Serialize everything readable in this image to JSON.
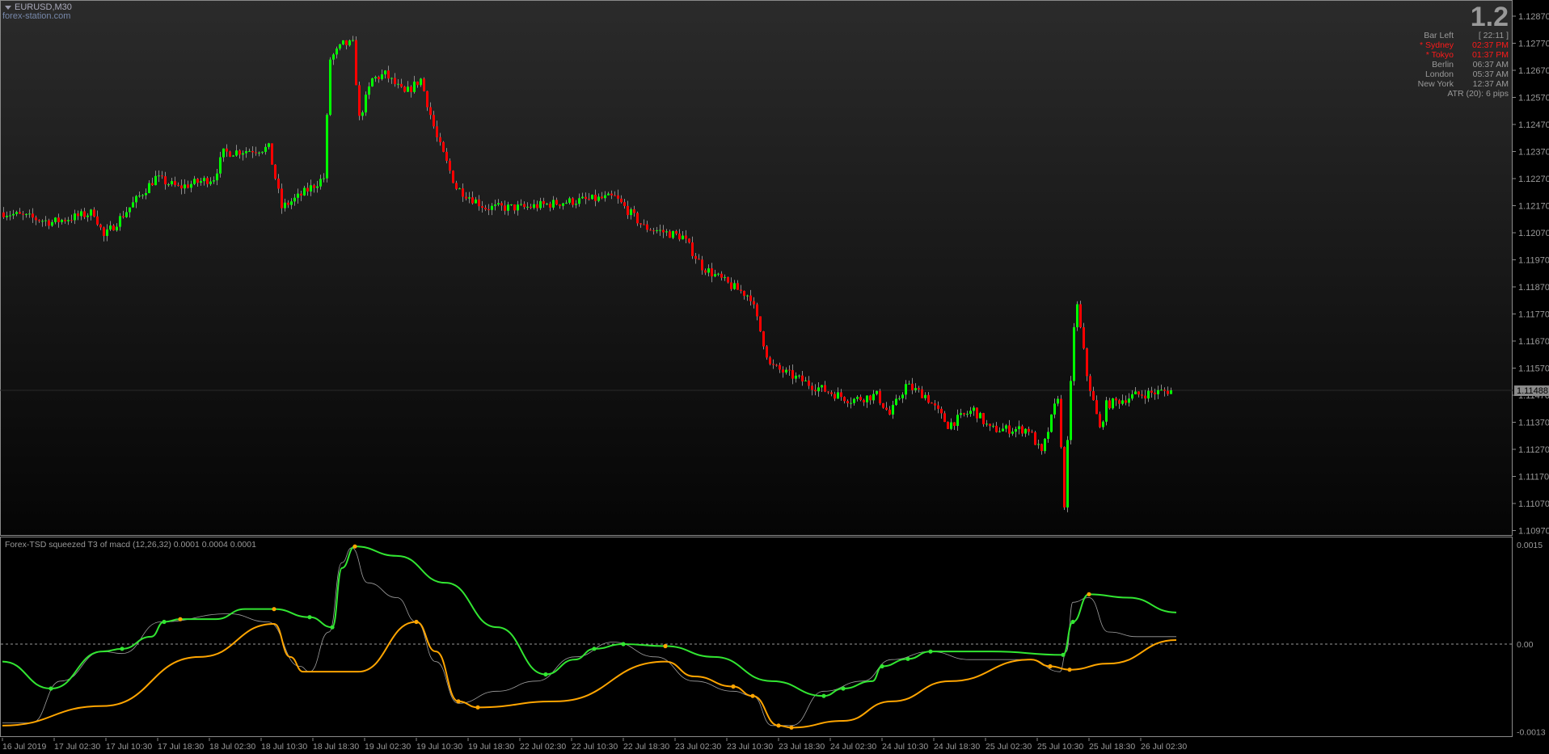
{
  "header": {
    "symbol": "EURUSD,M30",
    "site": "forex-station.com"
  },
  "info_panel": {
    "spread": "1.2",
    "rows": [
      {
        "label": "Bar Left",
        "value": "[ 22:11 ]",
        "color": "#999999"
      },
      {
        "label": "* Sydney",
        "value": "02:37 PM",
        "color": "#ff1a1a"
      },
      {
        "label": "* Tokyo",
        "value": "01:37 PM",
        "color": "#ff1a1a"
      },
      {
        "label": "Berlin",
        "value": "06:37 AM",
        "color": "#999999"
      },
      {
        "label": "London",
        "value": "05:37 AM",
        "color": "#999999"
      },
      {
        "label": "New York",
        "value": "12:37 AM",
        "color": "#999999"
      }
    ],
    "atr": "ATR (20): 6 pips"
  },
  "indicator": {
    "label": "Forex-TSD squeezed T3 of macd (12,26,32) 0.0001 0.0004 0.0001"
  },
  "colors": {
    "bull": "#00ff00",
    "bear": "#ff0000",
    "wick": "#8a8a8a",
    "signal": "#ffa500",
    "macd": "#32e632",
    "raw": "#a0a0a0"
  },
  "chart_data": [
    {
      "type": "candlestick",
      "title": "EURUSD,M30",
      "ylim": [
        1.10937,
        1.1289
      ],
      "price_ticks": [
        "1.12870",
        "1.12770",
        "1.12670",
        "1.12570",
        "1.12470",
        "1.12370",
        "1.12270",
        "1.12170",
        "1.12070",
        "1.11970",
        "1.11870",
        "1.11770",
        "1.11670",
        "1.11570",
        "1.11470",
        "1.11370",
        "1.11270",
        "1.11170",
        "1.11070",
        "1.10970"
      ],
      "current_price": "1.11488",
      "x_ticks": [
        "16 Jul 2019",
        "17 Jul 02:30",
        "17 Jul 10:30",
        "17 Jul 18:30",
        "18 Jul 02:30",
        "18 Jul 10:30",
        "18 Jul 18:30",
        "19 Jul 02:30",
        "19 Jul 10:30",
        "19 Jul 18:30",
        "22 Jul 02:30",
        "22 Jul 10:30",
        "22 Jul 18:30",
        "23 Jul 02:30",
        "23 Jul 10:30",
        "23 Jul 18:30",
        "24 Jul 02:30",
        "24 Jul 10:30",
        "24 Jul 18:30",
        "25 Jul 02:30",
        "25 Jul 10:30",
        "25 Jul 18:30",
        "26 Jul 02:30"
      ],
      "bars_per_tick": 16,
      "bar_count": 362,
      "close_keypoints": [
        [
          0,
          1.12145
        ],
        [
          15,
          1.12109
        ],
        [
          28,
          1.12145
        ],
        [
          31,
          1.12055
        ],
        [
          47,
          1.12273
        ],
        [
          54,
          1.12237
        ],
        [
          65,
          1.12273
        ],
        [
          68,
          1.12365
        ],
        [
          82,
          1.12383
        ],
        [
          86,
          1.12163
        ],
        [
          91,
          1.12201
        ],
        [
          99,
          1.12273
        ],
        [
          101,
          1.12712
        ],
        [
          105,
          1.12766
        ],
        [
          108,
          1.12766
        ],
        [
          110,
          1.12491
        ],
        [
          114,
          1.12637
        ],
        [
          118,
          1.12655
        ],
        [
          124,
          1.12583
        ],
        [
          129,
          1.12637
        ],
        [
          134,
          1.12419
        ],
        [
          140,
          1.12237
        ],
        [
          149,
          1.12163
        ],
        [
          161,
          1.12163
        ],
        [
          173,
          1.12183
        ],
        [
          189,
          1.12201
        ],
        [
          198,
          1.12091
        ],
        [
          210,
          1.12055
        ],
        [
          216,
          1.11945
        ],
        [
          225,
          1.11873
        ],
        [
          231,
          1.11834
        ],
        [
          237,
          1.1158
        ],
        [
          250,
          1.11506
        ],
        [
          262,
          1.11452
        ],
        [
          270,
          1.1147
        ],
        [
          274,
          1.11398
        ],
        [
          279,
          1.11506
        ],
        [
          285,
          1.1147
        ],
        [
          292,
          1.1136
        ],
        [
          300,
          1.11416
        ],
        [
          305,
          1.11344
        ],
        [
          317,
          1.11344
        ],
        [
          321,
          1.11252
        ],
        [
          326,
          1.1147
        ],
        [
          328,
          1.1107
        ],
        [
          331,
          1.11727
        ],
        [
          332,
          1.11798
        ],
        [
          335,
          1.11545
        ],
        [
          339,
          1.11344
        ],
        [
          341,
          1.11434
        ],
        [
          350,
          1.1147
        ],
        [
          361,
          1.11488
        ]
      ]
    },
    {
      "type": "line",
      "title": "Forex-TSD squeezed T3 of macd (12,26,32)",
      "ylim": [
        -0.0013,
        0.0015
      ],
      "y_ticks": [
        "0.0015",
        "0.00",
        "-0.0013"
      ],
      "zero_line": "dashed",
      "series": [
        {
          "name": "macd",
          "color": "#32e632",
          "points": [
            [
              0,
              -0.00026
            ],
            [
              15,
              -0.00066
            ],
            [
              31,
              -0.00011
            ],
            [
              37,
              -7e-05
            ],
            [
              46,
              0.00011
            ],
            [
              50,
              0.00033
            ],
            [
              55,
              0.00037
            ],
            [
              66,
              0.00037
            ],
            [
              75,
              0.00052
            ],
            [
              84,
              0.00052
            ],
            [
              95,
              0.0004
            ],
            [
              102,
              0.00025
            ],
            [
              105,
              0.00113
            ],
            [
              109,
              0.00145
            ],
            [
              122,
              0.00131
            ],
            [
              137,
              0.00091
            ],
            [
              153,
              0.00025
            ],
            [
              168,
              -0.00045
            ],
            [
              177,
              -0.00023
            ],
            [
              183,
              -7e-05
            ],
            [
              192,
              0.0
            ],
            [
              205,
              -3e-05
            ],
            [
              220,
              -0.00019
            ],
            [
              238,
              -0.00055
            ],
            [
              254,
              -0.00077
            ],
            [
              260,
              -0.00066
            ],
            [
              269,
              -0.00055
            ],
            [
              272,
              -0.00033
            ],
            [
              280,
              -0.00022
            ],
            [
              287,
              -0.00011
            ],
            [
              306,
              -0.00011
            ],
            [
              328,
              -0.00016
            ],
            [
              331,
              0.00033
            ],
            [
              336,
              0.00074
            ],
            [
              348,
              0.00069
            ],
            [
              363,
              0.00047
            ]
          ]
        },
        {
          "name": "signal",
          "color": "#ffa500",
          "points": [
            [
              0,
              -0.00121
            ],
            [
              31,
              -0.00092
            ],
            [
              61,
              -0.00019
            ],
            [
              84,
              0.0003
            ],
            [
              89,
              -0.00019
            ],
            [
              93,
              -0.00041
            ],
            [
              110,
              -0.00041
            ],
            [
              128,
              0.00033
            ],
            [
              134,
              -0.00011
            ],
            [
              141,
              -0.00085
            ],
            [
              147,
              -0.00094
            ],
            [
              171,
              -0.00085
            ],
            [
              205,
              -0.00026
            ],
            [
              214,
              -0.00048
            ],
            [
              226,
              -0.00063
            ],
            [
              232,
              -0.00077
            ],
            [
              240,
              -0.00121
            ],
            [
              244,
              -0.00124
            ],
            [
              260,
              -0.00114
            ],
            [
              275,
              -0.00085
            ],
            [
              293,
              -0.00055
            ],
            [
              318,
              -0.00023
            ],
            [
              324,
              -0.00033
            ],
            [
              330,
              -0.00038
            ],
            [
              342,
              -0.00029
            ],
            [
              363,
              6e-05
            ]
          ]
        },
        {
          "name": "raw",
          "color": "#a0a0a0",
          "points": [
            [
              0,
              -0.00117
            ],
            [
              9,
              -0.00117
            ],
            [
              18,
              -0.00055
            ],
            [
              31,
              -0.00011
            ],
            [
              37,
              -0.00014
            ],
            [
              49,
              0.00033
            ],
            [
              70,
              0.00045
            ],
            [
              82,
              0.00033
            ],
            [
              92,
              -0.00033
            ],
            [
              95,
              -0.00041
            ],
            [
              101,
              0.00018
            ],
            [
              105,
              0.00121
            ],
            [
              108,
              0.00143
            ],
            [
              113,
              0.00091
            ],
            [
              122,
              0.00069
            ],
            [
              128,
              0.00033
            ],
            [
              134,
              -0.00026
            ],
            [
              141,
              -0.00088
            ],
            [
              153,
              -0.0007
            ],
            [
              165,
              -0.00055
            ],
            [
              177,
              -0.00019
            ],
            [
              189,
              3e-05
            ],
            [
              202,
              -0.00019
            ],
            [
              214,
              -0.00055
            ],
            [
              226,
              -0.0007
            ],
            [
              232,
              -0.00077
            ],
            [
              238,
              -0.00121
            ],
            [
              244,
              -0.00121
            ],
            [
              254,
              -0.0007
            ],
            [
              266,
              -0.00055
            ],
            [
              275,
              -0.00023
            ],
            [
              287,
              -0.00011
            ],
            [
              299,
              -0.00023
            ],
            [
              318,
              -0.00023
            ],
            [
              327,
              -0.00041
            ],
            [
              329,
              -0.00011
            ],
            [
              331,
              0.00062
            ],
            [
              336,
              0.00069
            ],
            [
              342,
              0.00018
            ],
            [
              351,
              0.00011
            ],
            [
              363,
              0.00011
            ]
          ]
        }
      ],
      "markers": {
        "green": [
          15,
          37,
          50,
          95,
          102,
          168,
          183,
          192,
          254,
          260,
          272,
          280,
          287,
          328,
          331
        ],
        "orange": [
          55,
          84,
          109,
          128,
          141,
          147,
          205,
          226,
          232,
          240,
          244,
          324,
          330,
          336
        ]
      }
    }
  ]
}
